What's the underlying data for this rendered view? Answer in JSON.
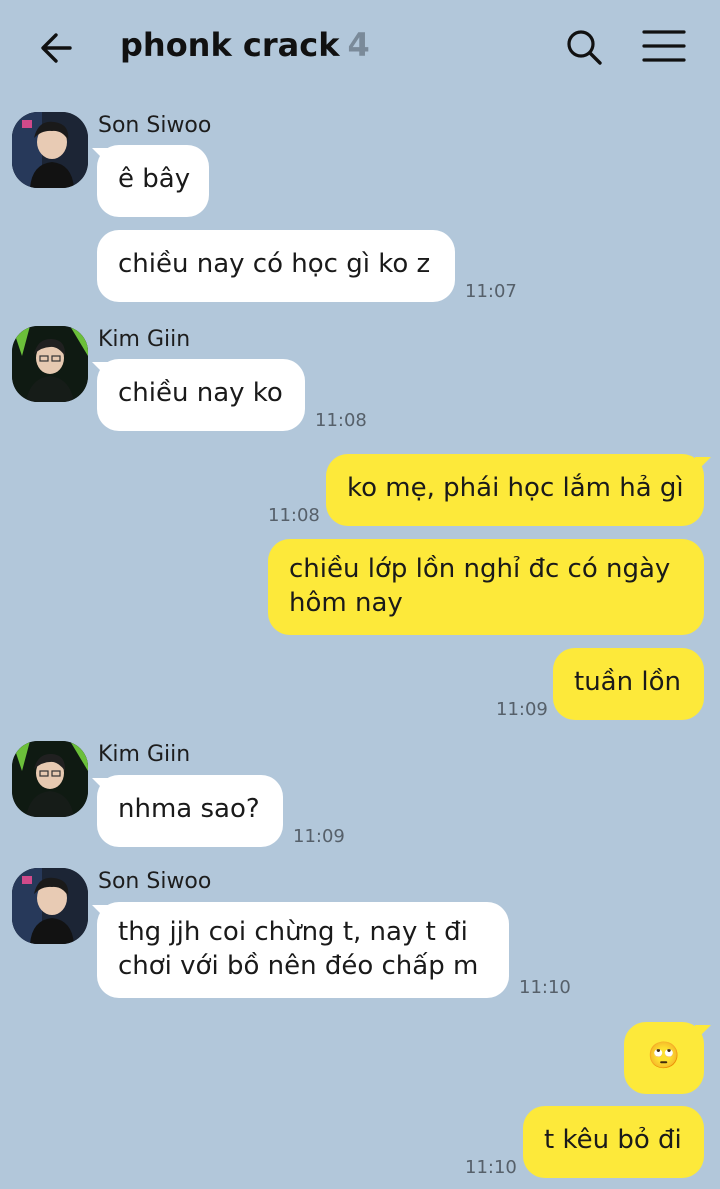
{
  "header": {
    "title": "phonk crack",
    "member_count": "4",
    "back_icon": "arrow-left-icon",
    "search_icon": "search-icon",
    "menu_icon": "hamburger-menu-icon"
  },
  "messages": [
    {
      "sender": "Son Siwoo",
      "text": "ê bây",
      "time": ""
    },
    {
      "sender": "Son Siwoo",
      "text": "chiều nay có học gì ko z",
      "time": "11:07"
    },
    {
      "sender": "Kim Giin",
      "text": "chiều nay ko",
      "time": "11:08"
    },
    {
      "sender": "me",
      "text": "ko mẹ, phái học lắm hả gì",
      "time": "11:08"
    },
    {
      "sender": "me",
      "text": "chiều lớp lồn nghỉ đc có ngày hôm nay",
      "time": ""
    },
    {
      "sender": "me",
      "text": "tuần lồn",
      "time": "11:09"
    },
    {
      "sender": "Kim Giin",
      "text": "nhma sao?",
      "time": "11:09"
    },
    {
      "sender": "Son Siwoo",
      "text": "thg jjh coi chừng t, nay t đi chơi với bồ nên đéo chấp m",
      "time": "11:10"
    },
    {
      "sender": "me",
      "text": "🙄",
      "time": ""
    },
    {
      "sender": "me",
      "text": "t kêu bỏ đi",
      "time": "11:10"
    }
  ],
  "colors": {
    "background": "#b2c7da",
    "incoming_bubble": "#ffffff",
    "outgoing_bubble": "#fde93a"
  }
}
